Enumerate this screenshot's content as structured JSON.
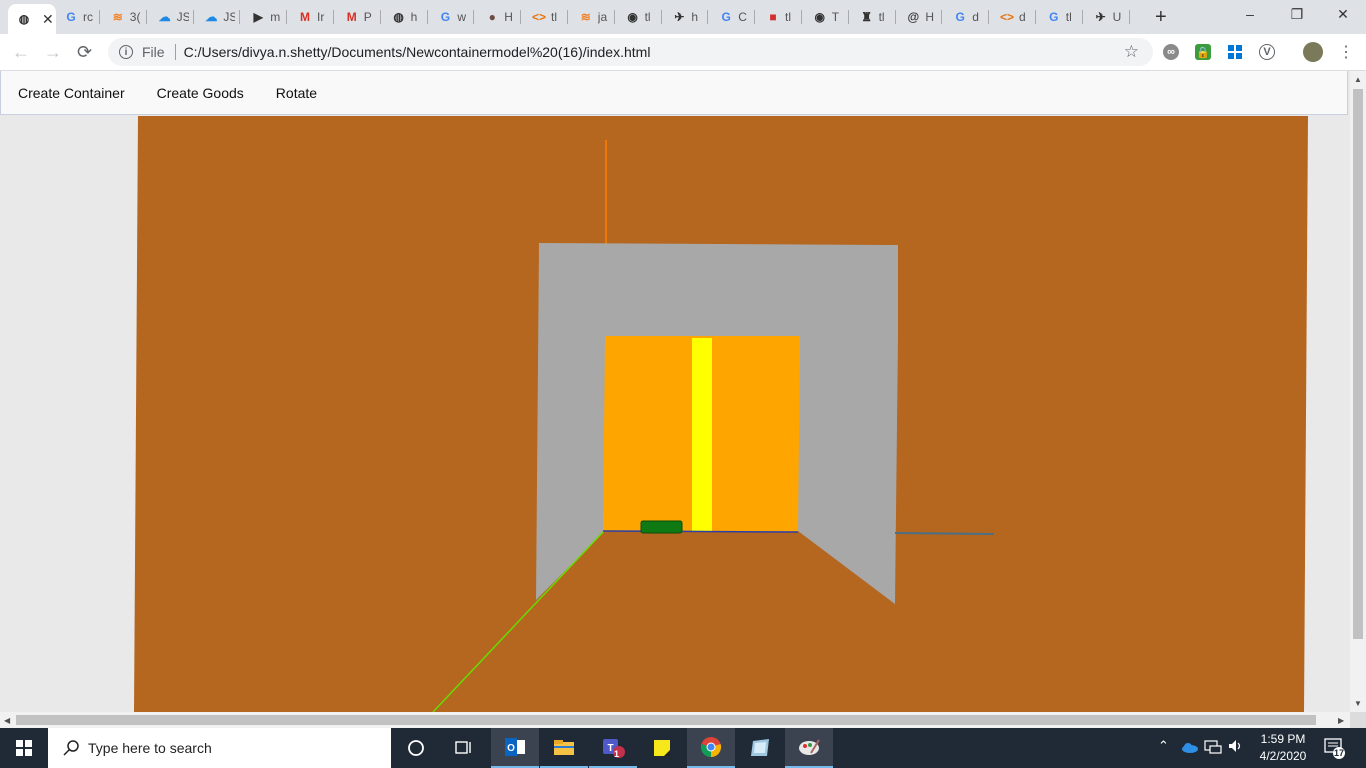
{
  "browser": {
    "tabs": [
      {
        "icon": "globe-icon",
        "label": "",
        "active": true
      },
      {
        "icon": "google-icon",
        "label": "rc"
      },
      {
        "icon": "stackoverflow-icon",
        "label": "3("
      },
      {
        "icon": "cloud-icon",
        "label": "JS"
      },
      {
        "icon": "cloud-icon",
        "label": "JS"
      },
      {
        "icon": "arrow-logo-icon",
        "label": "m"
      },
      {
        "icon": "gmail-icon",
        "label": "Ir"
      },
      {
        "icon": "gmail-icon",
        "label": "P"
      },
      {
        "icon": "globe-icon",
        "label": "h"
      },
      {
        "icon": "google-icon",
        "label": "w"
      },
      {
        "icon": "avatar-icon",
        "label": "H"
      },
      {
        "icon": "code-icon",
        "label": "tl"
      },
      {
        "icon": "stackoverflow-icon",
        "label": "ja"
      },
      {
        "icon": "github-icon",
        "label": "tl"
      },
      {
        "icon": "plane-icon",
        "label": "h"
      },
      {
        "icon": "google-icon",
        "label": "C"
      },
      {
        "icon": "square-logo-icon",
        "label": "tl"
      },
      {
        "icon": "github-icon",
        "label": "T"
      },
      {
        "icon": "person-icon",
        "label": "tl"
      },
      {
        "icon": "at-icon",
        "label": "H"
      },
      {
        "icon": "google-icon",
        "label": "d"
      },
      {
        "icon": "code-icon",
        "label": "d"
      },
      {
        "icon": "google-icon",
        "label": "tl"
      },
      {
        "icon": "plane-icon",
        "label": "U"
      }
    ],
    "new_tab": "+",
    "window": {
      "minimize": "–",
      "restore": "❐",
      "close": "✕"
    },
    "toolbar": {
      "scheme": "File",
      "url": "C:/Users/divya.n.shetty/Documents/Newcontainermodel%20(16)/index.html"
    }
  },
  "app": {
    "menu": [
      "Create Container",
      "Create Goods",
      "Rotate"
    ],
    "scene": {
      "background": "#b5661f",
      "container_color": "#a8a8a8",
      "goods_color": "#ffa500",
      "highlight_color": "#ffff00",
      "small_box_color": "#0f7a14"
    }
  },
  "taskbar": {
    "search_placeholder": "Type here to search",
    "time": "1:59 PM",
    "date": "4/2/2020",
    "notification_count": "17",
    "teams_badge": "1"
  }
}
